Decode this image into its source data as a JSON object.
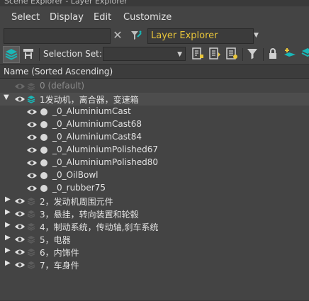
{
  "window": {
    "title": "Scene Explorer - Layer Explorer"
  },
  "menu": [
    "Select",
    "Display",
    "Edit",
    "Customize"
  ],
  "search": {
    "value": ""
  },
  "explorer_selector": {
    "value": "Layer Explorer"
  },
  "toolbar": {
    "selection_set_label": "Selection Set:",
    "selection_set_value": ""
  },
  "column_header": "Name (Sorted Ascending)",
  "tree": {
    "default_layer": "0 (default)",
    "expanded_layer": "1发动机，离合器，变速箱",
    "children": [
      "_0_AluminiumCast",
      "_0_AluminiumCast68",
      "_0_AluminiumCast84",
      "_0_AluminiumPolished67",
      "_0_AluminiumPolished80",
      "_0_OilBowl",
      "_0_rubber75"
    ],
    "collapsed_layers": [
      "2，发动机周围元件",
      "3，悬挂，转向装置和轮毂",
      "4，制动系统，传动轴,刹车系统",
      "5，电器",
      "6，内饰件",
      "7，车身件"
    ]
  },
  "colors": {
    "background": "#444444",
    "accent_layer": "#19b7b7",
    "dropdown_text": "#e8c53a"
  }
}
